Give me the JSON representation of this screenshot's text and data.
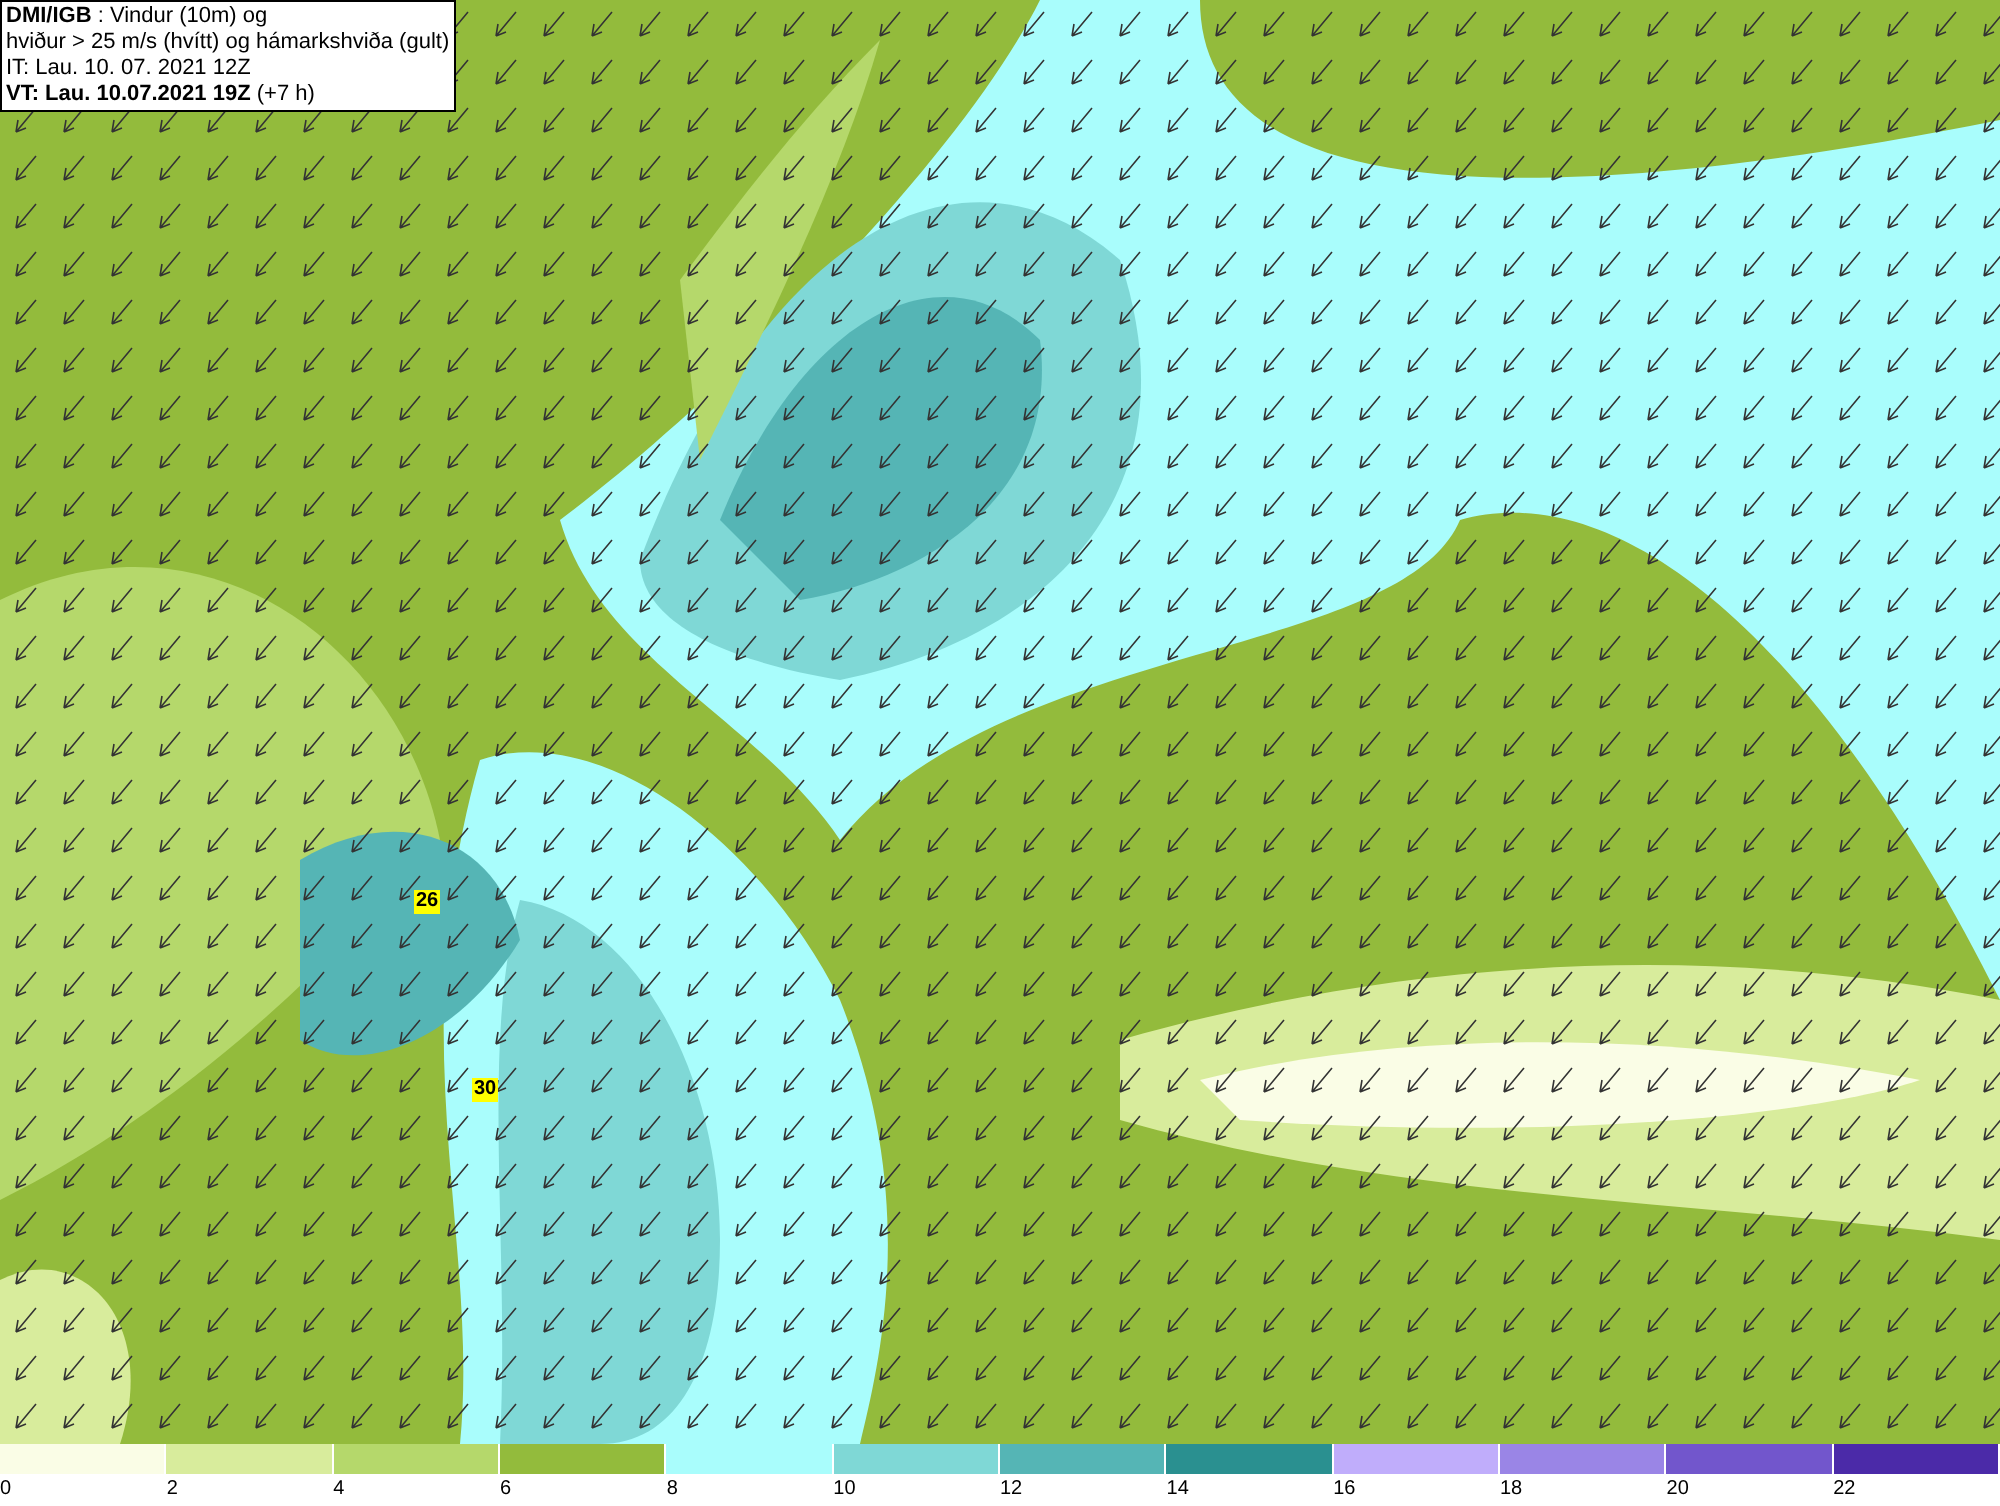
{
  "header": {
    "lines": [
      "**DMI/IGB** : Vindur (10m) og",
      "hviður > 25 m/s (hvítt) og hámarkshviða (gult)",
      "IT: Lau. 10. 07. 2021 12Z",
      "**VT: Lau. 10.07.2021 19Z** (+7 h)"
    ]
  },
  "map": {
    "gust_labels": [
      {
        "text": "26"
      },
      {
        "text": "30"
      }
    ]
  },
  "legend": {
    "segments": [
      {
        "color": "#fafde6",
        "label": "0"
      },
      {
        "color": "#d8ec9c",
        "label": "2"
      },
      {
        "color": "#b5d86b",
        "label": "4"
      },
      {
        "color": "#93bb3c",
        "label": "6"
      },
      {
        "color": "#a9fdfc",
        "label": "8"
      },
      {
        "color": "#7fd8d6",
        "label": "10"
      },
      {
        "color": "#55b5b5",
        "label": "12"
      },
      {
        "color": "#2a9090",
        "label": "14"
      },
      {
        "color": "#c0adfb",
        "label": "16"
      },
      {
        "color": "#9a85e6",
        "label": "18"
      },
      {
        "color": "#7256cc",
        "label": "20"
      },
      {
        "color": "#4b2aa8",
        "label": "22"
      }
    ]
  }
}
